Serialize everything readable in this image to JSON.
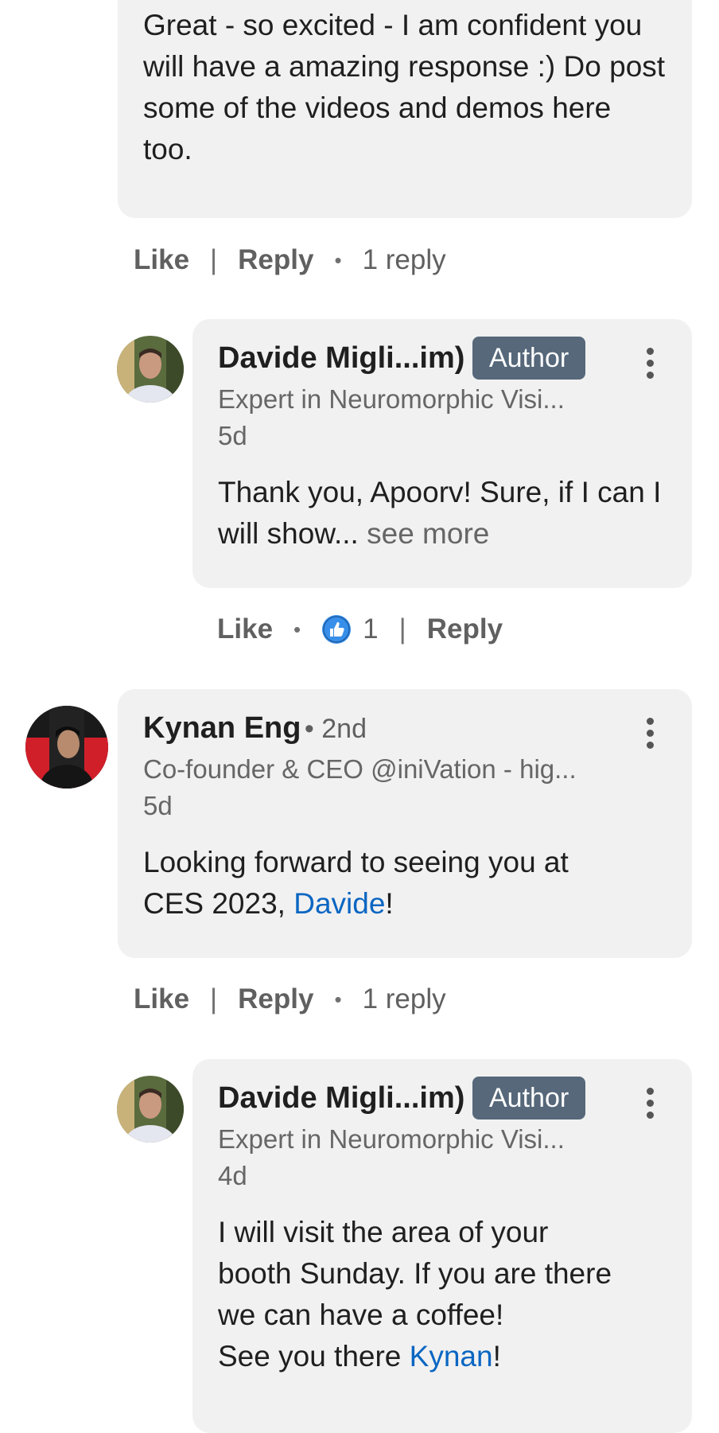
{
  "comment_top": {
    "body": "Great - so excited - I am confident you will have a amazing response :) Do post some of the videos and demos here too.",
    "actions": {
      "like": "Like",
      "reply": "Reply",
      "replies": "1 reply"
    }
  },
  "reply_1": {
    "name": "Davide Migli...im)",
    "badge": "Author",
    "headline": "Expert in Neuromorphic Visi...",
    "time": "5d",
    "body": "Thank you, Apoorv! Sure, if I can I will show...",
    "see_more": "see more",
    "actions": {
      "like": "Like",
      "reaction_count": "1",
      "reply": "Reply"
    }
  },
  "comment_kynan": {
    "name": "Kynan Eng",
    "degree": "• 2nd",
    "headline": "Co-founder & CEO @iniVation - hig...",
    "time": "5d",
    "body_prefix": "Looking forward to seeing you at CES 2023,",
    "mention": "Davide",
    "body_suffix": "!",
    "actions": {
      "like": "Like",
      "reply": "Reply",
      "replies": "1 reply"
    }
  },
  "reply_2": {
    "name": "Davide Migli...im)",
    "badge": "Author",
    "headline": "Expert in Neuromorphic Visi...",
    "time": "4d",
    "line1": "I will visit the area of your",
    "line2": "booth Sunday. If you are there",
    "line3": "we can have a coffee!",
    "line4_prefix": "See you there",
    "mention": "Kynan",
    "line4_suffix": "!"
  },
  "icons": {
    "more": "three-dots-vertical-icon",
    "reaction": "like-reaction-icon",
    "separator_pipe": "|",
    "separator_dot": "•"
  },
  "colors": {
    "bubble": "#f1f1f1",
    "author_badge": "#56687a",
    "mention": "#0a66c2",
    "like_icon": "#378fe9"
  }
}
